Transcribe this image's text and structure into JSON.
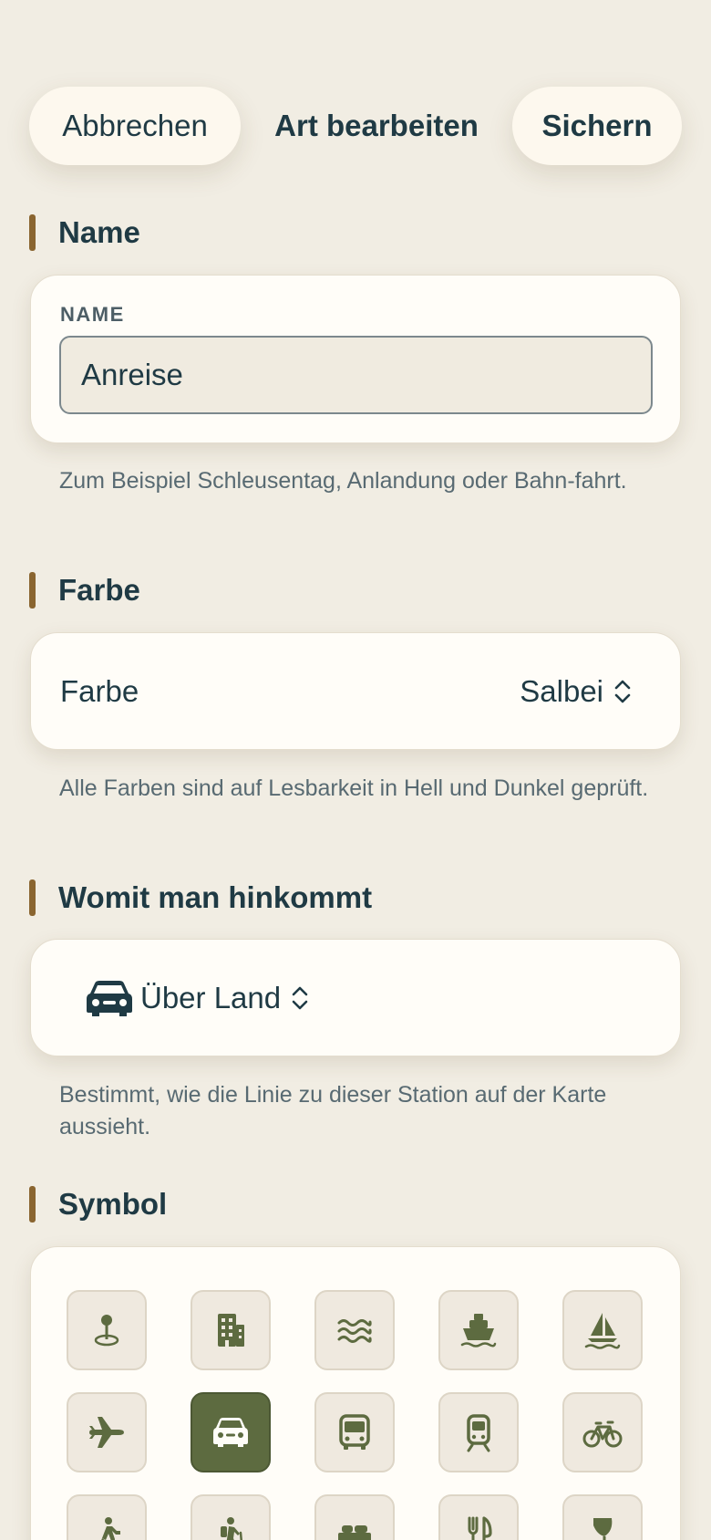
{
  "nav": {
    "cancel_label": "Abbrechen",
    "title": "Art bearbeiten",
    "save_label": "Sichern"
  },
  "name_section": {
    "header": "Name",
    "field_label": "NAME",
    "value": "Anreise",
    "hint": "Zum Beispiel Schleusentag, Anlandung oder Bahn-fahrt."
  },
  "color_section": {
    "header": "Farbe",
    "row_label": "Farbe",
    "selected": "Salbei",
    "hint": "Alle Farben sind auf Lesbarkeit in Hell und Dunkel geprüft."
  },
  "transport_section": {
    "header": "Womit man hinkommt",
    "icon": "car-icon",
    "selected": "Über Land",
    "hint": "Bestimmt, wie die Linie zu dieser Station auf der Karte aussieht."
  },
  "symbol_section": {
    "header": "Symbol",
    "selected_index": 6,
    "symbols": [
      "pin-icon",
      "building-icon",
      "water-icon",
      "ferry-icon",
      "sailboat-icon",
      "airplane-icon",
      "car-icon",
      "bus-icon",
      "tram-icon",
      "bicycle-icon",
      "walking-icon",
      "hiking-icon",
      "bed-icon",
      "restaurant-icon",
      "wine-icon"
    ]
  },
  "colors": {
    "background": "#f1ede3",
    "card": "#fffdf8",
    "text": "#1f3a44",
    "accent_bar": "#8a6530",
    "icon": "#5d6b40",
    "selected_tile": "#5d6b40"
  }
}
